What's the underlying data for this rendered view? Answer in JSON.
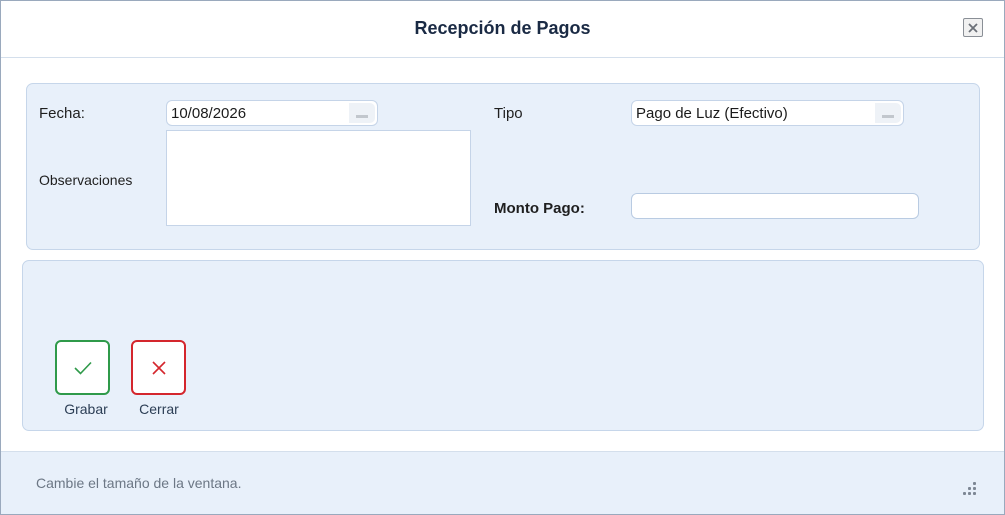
{
  "window": {
    "title": "Recepción de Pagos"
  },
  "form": {
    "fecha_label": "Fecha:",
    "fecha_value": "10/08/2026",
    "observaciones_label": "Observaciones",
    "observaciones_value": "",
    "tipo_label": "Tipo",
    "tipo_value": "Pago de Luz (Efectivo)",
    "monto_label": "Monto Pago:",
    "monto_value": ""
  },
  "actions": {
    "save_label": "Grabar",
    "close_label": "Cerrar",
    "save_color": "#2f9a4a",
    "close_color": "#d4262d"
  },
  "footer": {
    "status_text": "Cambie el tamaño de la ventana."
  },
  "icons": {
    "close_window": "close-icon",
    "save": "check-icon",
    "cancel": "x-icon",
    "dropdown": "dropdown-arrow-icon",
    "resize": "resize-grip-icon"
  }
}
